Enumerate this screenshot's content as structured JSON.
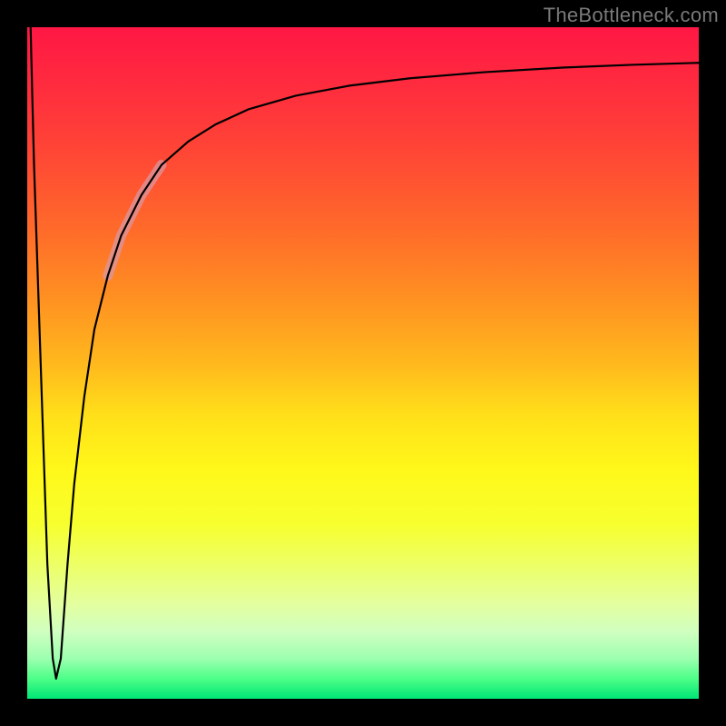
{
  "watermark": "TheBottleneck.com",
  "chart_data": {
    "type": "line",
    "title": "",
    "xlabel": "",
    "ylabel": "",
    "xlim": [
      0,
      100
    ],
    "ylim": [
      0,
      100
    ],
    "grid": false,
    "legend": false,
    "series": [
      {
        "name": "curve",
        "x": [
          0.5,
          1.0,
          2.0,
          3.0,
          3.8,
          4.3,
          5.0,
          6.0,
          7.0,
          8.5,
          10.0,
          12.0,
          14.0,
          17.0,
          20.0,
          24.0,
          28.0,
          33.0,
          40.0,
          48.0,
          57.0,
          68.0,
          80.0,
          90.0,
          100.0
        ],
        "y": [
          100.0,
          80.0,
          50.0,
          20.0,
          6.0,
          3.0,
          6.0,
          20.0,
          32.0,
          45.0,
          55.0,
          63.0,
          69.0,
          75.0,
          79.5,
          83.0,
          85.5,
          87.8,
          89.8,
          91.3,
          92.4,
          93.3,
          94.0,
          94.4,
          94.7
        ],
        "note": "estimated from pixel positions; y=0 means bottom of plot, y=100 means top"
      }
    ],
    "highlight_segment": {
      "x_start": 12.0,
      "x_end": 20.0
    },
    "colors": {
      "curve": "#000000",
      "highlight": "#d59aa3",
      "frame": "#000000",
      "gradient_top": "#ff1744",
      "gradient_mid": "#fff81a",
      "gradient_bottom": "#00e676"
    }
  }
}
